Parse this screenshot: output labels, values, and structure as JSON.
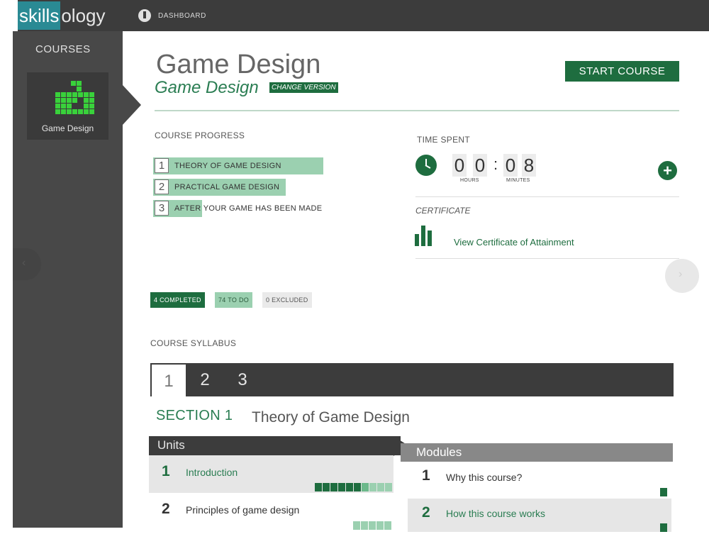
{
  "header": {
    "logo_skills": "skills",
    "logo_ology": "ology",
    "dashboard_label": "DASHBOARD"
  },
  "sidebar": {
    "title": "COURSES",
    "course_label": "Game Design"
  },
  "course": {
    "title": "Game Design",
    "version_name": "Game Design",
    "change_version_label": "CHANGE VERSION",
    "start_label": "START COURSE"
  },
  "progress": {
    "label": "COURSE PROGRESS",
    "items": [
      {
        "num": "1",
        "text": "THEORY OF GAME DESIGN",
        "fill": 1.0
      },
      {
        "num": "2",
        "text": "PRACTICAL GAME DESIGN",
        "fill": 0.78
      },
      {
        "num": "3",
        "text": "AFTER YOUR GAME HAS BEEN MADE",
        "fill": 0.27
      }
    ]
  },
  "time": {
    "label": "TIME SPENT",
    "hours": [
      "0",
      "0"
    ],
    "minutes": [
      "0",
      "8"
    ],
    "separator": ":",
    "hours_label": "HOURS",
    "minutes_label": "MINUTES"
  },
  "certificate": {
    "label": "CERTIFICATE",
    "link": "View Certificate of Attainment"
  },
  "badges": {
    "completed": "4 COMPLETED",
    "todo": "74 TO DO",
    "excluded": "0 EXCLUDED"
  },
  "syllabus": {
    "label": "COURSE SYLLABUS",
    "tabs": [
      "1",
      "2",
      "3"
    ],
    "section_label": "SECTION 1",
    "section_name": "Theory of Game Design",
    "units_header": "Units",
    "modules_header": "Modules",
    "units": [
      {
        "num": "1",
        "title": "Introduction"
      },
      {
        "num": "2",
        "title": "Principles of game design"
      }
    ],
    "modules": [
      {
        "num": "1",
        "title": "Why this course?"
      },
      {
        "num": "2",
        "title": "How this course works"
      }
    ]
  },
  "colors": {
    "accent": "#1e6d3f",
    "accent_light": "#9bd0b0",
    "dark": "#3c3c3c",
    "logo_teal": "#2a8a94"
  }
}
